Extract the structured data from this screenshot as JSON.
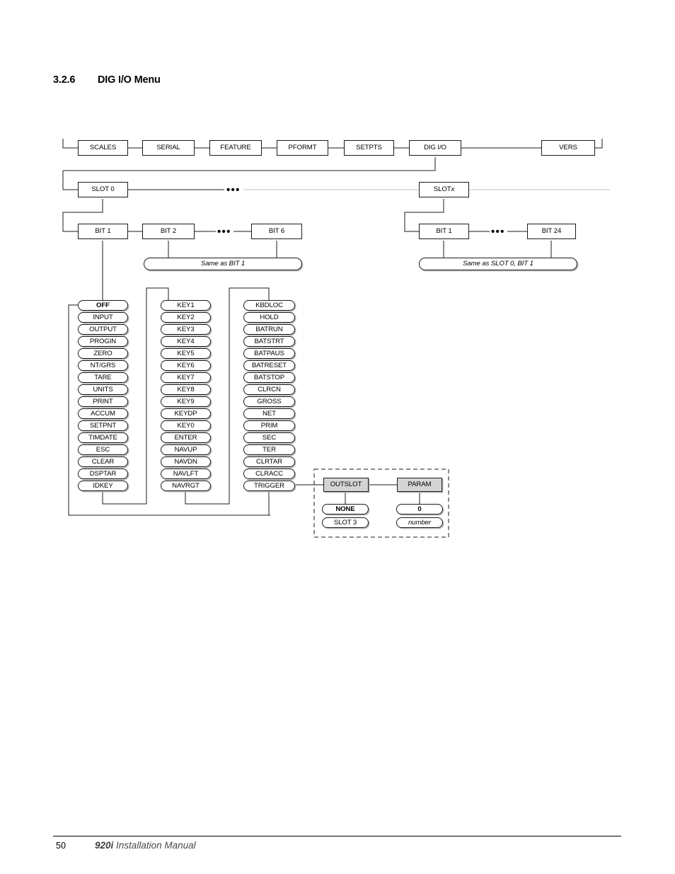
{
  "heading": {
    "number": "3.2.6",
    "title": "DIG I/O Menu"
  },
  "top_menu": {
    "items": [
      {
        "label": "SCALES"
      },
      {
        "label": "SERIAL"
      },
      {
        "label": "FEATURE"
      },
      {
        "label": "PFORMT"
      },
      {
        "label": "SETPTS"
      },
      {
        "label": "DIG I/O"
      },
      {
        "label": "VERS"
      }
    ]
  },
  "slot_row": {
    "left": "SLOT 0",
    "right_prefix": "SLOT ",
    "right_italic": "x",
    "ellipsis": "•••"
  },
  "bit_row_left": {
    "items": [
      "BIT 1",
      "BIT 2",
      "BIT 6"
    ],
    "ellipsis": "•••"
  },
  "bit_row_right": {
    "items": [
      "BIT 1",
      "BIT 24"
    ],
    "ellipsis": "•••"
  },
  "notes": {
    "left": "Same as BIT 1",
    "right": "Same as SLOT 0, BIT 1"
  },
  "columns": {
    "col1": [
      "OFF",
      "INPUT",
      "OUTPUT",
      "PROGIN",
      "ZERO",
      "NT/GRS",
      "TARE",
      "UNITS",
      "PRINT",
      "ACCUM",
      "SETPNT",
      "TIMDATE",
      "ESC",
      "CLEAR",
      "DSPTAR",
      "IDKEY"
    ],
    "col2": [
      "KEY1",
      "KEY2",
      "KEY3",
      "KEY4",
      "KEY5",
      "KEY6",
      "KEY7",
      "KEY8",
      "KEY9",
      "KEYDP",
      "KEY0",
      "ENTER",
      "NAVUP",
      "NAVDN",
      "NAVLFT",
      "NAVRGT"
    ],
    "col3": [
      "KBDLOC",
      "HOLD",
      "BATRUN",
      "BATSTRT",
      "BATPAUS",
      "BATRESET",
      "BATSTOP",
      "CLRCN",
      "GROSS",
      "NET",
      "PRIM",
      "SEC",
      "TER",
      "CLRTAR",
      "CLRACC",
      "TRIGGER"
    ],
    "default_col1": "OFF"
  },
  "trigger_group": {
    "outslot": {
      "header": "OUTSLOT",
      "values": [
        "NONE",
        "SLOT 3"
      ],
      "default": "NONE"
    },
    "param": {
      "header": "PARAM",
      "values": [
        "0",
        "number"
      ],
      "default": "0"
    }
  },
  "footer": {
    "page": "50",
    "product": "920i",
    "manual": "Installation Manual"
  },
  "colors": {
    "line": "#1b1b1b",
    "gray_fill": "#d4d4d4",
    "shadow": "#b9b9b9",
    "faded_line": "#bfbfbf"
  }
}
